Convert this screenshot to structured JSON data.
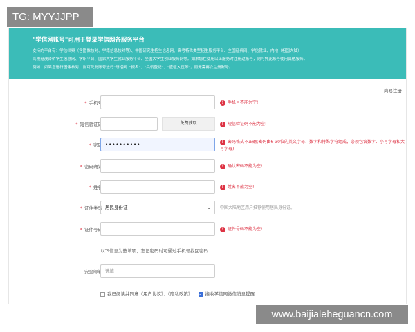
{
  "watermarks": {
    "top_left": "TG: MYYJJPP",
    "bottom_right": "www.baijialeheguancn.com"
  },
  "banner": {
    "title": "\"学信网账号\"可用于登录学信网各服务平台",
    "lines": [
      "支持的平台有：学信档案（含图像核对、学籍信息核对等）、中国研究生招生信息网、高考特殊类型招生服务平台、全国征兵网、学信就业、内地（祖国大陆）",
      "高校港澳台侨学生信息网、学职平台、国家大学生就业服务平台、全国大学生创业服务网等。如果您在使用以上服务时注册过账号，则可凭此账号使用其他服务。",
      "例如：如果您进行图像核对，则可凭此账号进行\"研招网上报名\"、\"兵役登记\"、\"应征入伍等\"，而无需再次注册账号。"
    ]
  },
  "top_link": "简易注册",
  "form": {
    "phone": {
      "label": "手机号",
      "value": "",
      "error": "手机号不能为空!"
    },
    "sms": {
      "label": "短信验证码",
      "value": "",
      "button": "免费获取",
      "error": "短信验证码不能为空!"
    },
    "password": {
      "label": "密码",
      "value": "••••••••••",
      "error": "密码格式不正确(密码由6-30位的英文字母、数字和特殊字符组成，必须包含数字、小写字母和大写字母)"
    },
    "password_confirm": {
      "label": "密码确认",
      "value": "",
      "error": "确认密码不能为空!"
    },
    "name": {
      "label": "姓名",
      "value": "",
      "error": "姓名不能为空!"
    },
    "id_type": {
      "label": "证件类型",
      "value": "居民身份证",
      "hint": "中国大陆地区用户推荐使用居民身份证。"
    },
    "id_number": {
      "label": "证件号码",
      "value": "",
      "error": "证件号码不能为空!"
    },
    "optional_note": "以下信息为选填项，忘记密码时可通过手机号找回密码",
    "email": {
      "label": "安全邮箱",
      "placeholder": "选填"
    },
    "agree_text_1": "我已阅读并同意《用户协议》、《隐私政策》",
    "agree_text_2": "接收学信网微信消息提醒"
  }
}
